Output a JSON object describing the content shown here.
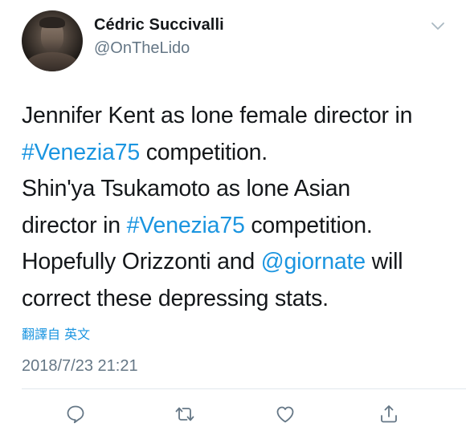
{
  "author": {
    "display_name": "Cédric Succivalli",
    "handle": "@OnTheLido"
  },
  "tweet": {
    "lines": [
      [
        {
          "text": "Jennifer Kent as lone female director in",
          "link": false
        }
      ],
      [
        {
          "text": "#Venezia75",
          "link": true
        },
        {
          "text": " competition.",
          "link": false
        }
      ],
      [
        {
          "text": "Shin'ya Tsukamoto as lone Asian",
          "link": false
        }
      ],
      [
        {
          "text": "director in ",
          "link": false
        },
        {
          "text": "#Venezia75",
          "link": true
        },
        {
          "text": " competition.",
          "link": false
        }
      ],
      [
        {
          "text": "Hopefully Orizzonti and ",
          "link": false
        },
        {
          "text": "@giornate",
          "link": true
        },
        {
          "text": " will",
          "link": false
        }
      ],
      [
        {
          "text": "correct these depressing stats.",
          "link": false
        }
      ]
    ],
    "translate_label": "翻譯自 英文",
    "timestamp": "2018/7/23 21:21"
  },
  "actions": {
    "icons": [
      "reply-icon",
      "retweet-icon",
      "like-icon",
      "share-icon"
    ]
  },
  "colors": {
    "text": "#14171a",
    "secondary": "#657786",
    "link": "#1b95e0",
    "divider": "#e1e8ed"
  }
}
